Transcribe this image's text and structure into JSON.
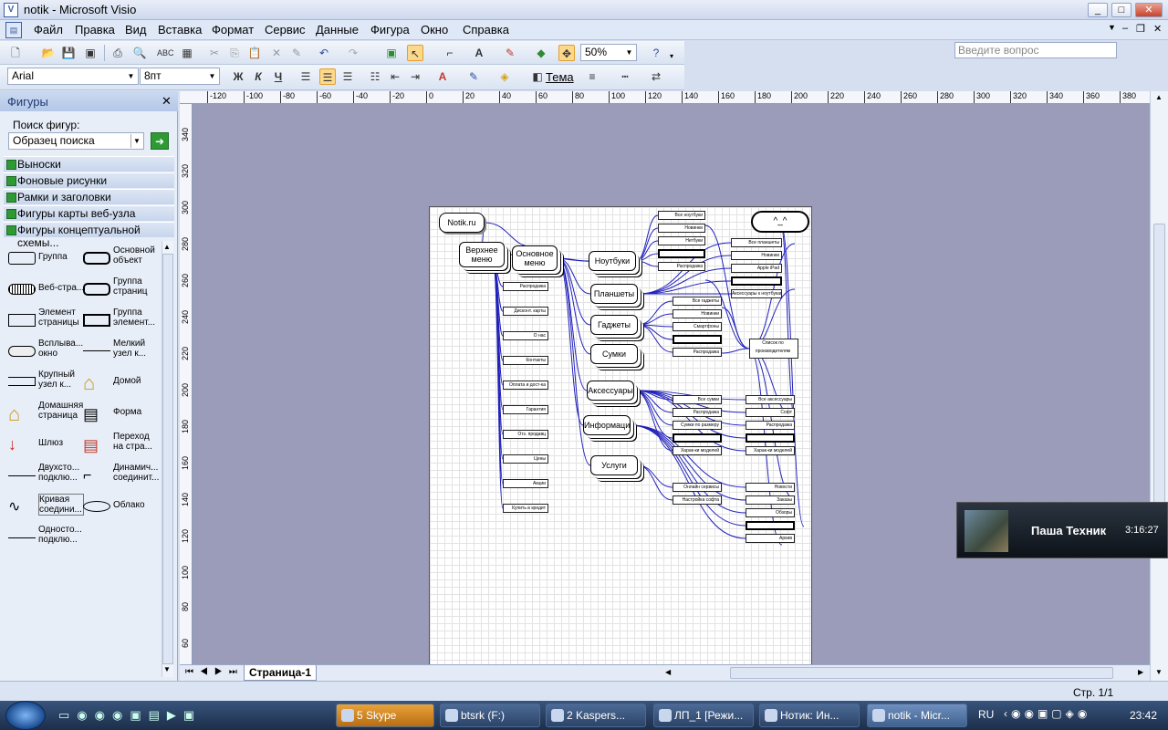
{
  "window": {
    "title": "notik - Microsoft Visio",
    "ask_placeholder": "Введите вопрос"
  },
  "menu": [
    "Файл",
    "Правка",
    "Вид",
    "Вставка",
    "Формат",
    "Сервис",
    "Данные",
    "Фигура",
    "Окно",
    "Справка"
  ],
  "toolbar": {
    "zoom": "50%",
    "font": "Arial",
    "size": "8пт",
    "theme": "Тема",
    "bold": "Ж",
    "italic": "К",
    "underline": "Ч"
  },
  "panel": {
    "title": "Фигуры",
    "search_label": "Поиск фигур:",
    "search_value": "Образец поиска",
    "stencils": [
      "Выноски",
      "Фоновые рисунки",
      "Рамки и заголовки",
      "Фигуры карты веб-узла",
      "Фигуры концептуальной схемы..."
    ],
    "shapes": [
      "Группа",
      "Основной объект",
      "Веб-стра...",
      "Группа страниц",
      "Элемент страницы",
      "Группа элемент...",
      "Всплыва... окно",
      "Мелкий узел к...",
      "Крупный узел к...",
      "Домой",
      "Домашняя страница",
      "Форма",
      "Шлюз",
      "Переход на стра...",
      "Двухсто... подклю...",
      "Динамич... соединит...",
      "Кривая соедини...",
      "Облако",
      "Односто... подклю..."
    ]
  },
  "ruler_h": [
    "-120",
    "-100",
    "-80",
    "-60",
    "-40",
    "-20",
    "0",
    "20",
    "40",
    "60",
    "80",
    "100",
    "120",
    "140",
    "160",
    "180",
    "200",
    "220",
    "240",
    "260",
    "280",
    "300",
    "320",
    "340",
    "360",
    "380"
  ],
  "ruler_v": [
    "340",
    "320",
    "300",
    "280",
    "260",
    "240",
    "220",
    "200",
    "180",
    "160",
    "140",
    "120",
    "100",
    "80",
    "60"
  ],
  "diagram": {
    "root": "Notik.ru",
    "top_menu": "Верхнее меню",
    "main_menu": "Основное меню",
    "cloud": "^_^",
    "categories": [
      "Ноутбуки",
      "Планшеты",
      "Гаджеты",
      "Сумки",
      "Аксессуары",
      "Информация",
      "Услуги"
    ],
    "top_items": [
      "Распродажа",
      "Дисконт. карты",
      "О нас",
      "Контакты",
      "Оплата и дост-ка",
      "Гарантия",
      "Отз. продавц",
      "Цены",
      "Акции",
      "Купить в кредит"
    ],
    "notebooks": [
      "Все ноутбуки",
      "Новинки",
      "Нетбуки",
      "",
      "Распродажа"
    ],
    "tablets": [
      "Все планшеты",
      "Новинки",
      "Apple iPad",
      "",
      "Аксессуары к ноутбукам"
    ],
    "gadgets": [
      "Все гаджеты",
      "Новинки",
      "Смартфоны",
      "",
      "Распродажа"
    ],
    "makers": "Список по производителям",
    "bags": [
      "Все сумки",
      "Распродажа",
      "Сумки по размеру",
      "",
      "Харак-ки моделей"
    ],
    "acc": [
      "Все аксессуары",
      "Софт",
      "Распродажа",
      "",
      "Харак-ки моделей"
    ],
    "services": [
      "Онлайн сервисы",
      "Настройка софта"
    ],
    "info": [
      "Новости",
      "Заказы",
      "Обзоры",
      "",
      "Архив"
    ]
  },
  "tabs": {
    "page": "Страница-1"
  },
  "status": {
    "page": "Стр. 1/1"
  },
  "popup": {
    "name": "Паша Техник",
    "time": "3:16:27"
  },
  "taskbar": {
    "items": [
      "5 Skype",
      "btsrk (F:)",
      "2 Kaspers...",
      "ЛП_1 [Режи...",
      "Нотик: Ин...",
      "notik - Micr..."
    ],
    "lang": "RU",
    "clock": "23:42"
  }
}
